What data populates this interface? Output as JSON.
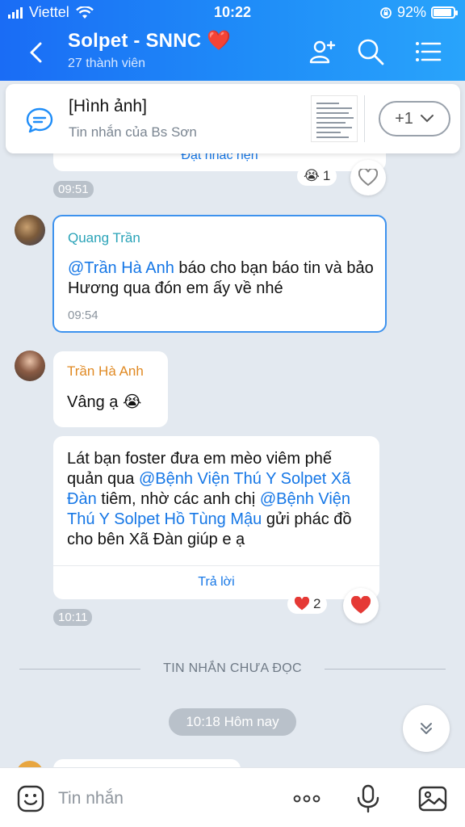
{
  "status_bar": {
    "carrier": "Viettel",
    "time": "10:22",
    "battery": "92%"
  },
  "header": {
    "title": "Solpet - SNNC ❤️",
    "subtitle": "27 thành viên"
  },
  "pinned": {
    "title": "[Hình ảnh]",
    "subtitle": "Tin nhắn của Bs Sơn",
    "more": "+1"
  },
  "messages": {
    "prev": {
      "partial_text": "Đặt nhắc hẹn",
      "time": "09:51",
      "reaction_count": "1"
    },
    "quang": {
      "sender": "Quang Trần",
      "mention": "@Trần Hà Anh",
      "text": " báo cho bạn báo tin và bảo Hương qua đón em ấy về nhé",
      "time": "09:54"
    },
    "hanh1": {
      "sender": "Trần Hà Anh",
      "text": "Vâng ạ 😭"
    },
    "hanh2": {
      "text_a": "Lát bạn foster đưa em mèo viêm phế quản qua ",
      "mention_a": "@Bệnh Viện Thú Y Solpet Xã Đàn",
      "text_b": " tiêm, nhờ các anh chị ",
      "mention_b": "@Bệnh Viện Thú Y Solpet Hồ Tùng Mậu",
      "text_c": " gửi phác đồ cho bên Xã Đàn giúp e ạ",
      "reply": "Trả lời",
      "time": "10:11",
      "reaction_count": "2"
    }
  },
  "unread_divider": "TIN NHẮN CHƯA ĐỌC",
  "date_pill": "10:18 Hôm nay",
  "input": {
    "placeholder": "Tin nhắn"
  },
  "colors": {
    "accent": "#1f8df8",
    "mention": "#1677e6",
    "sender_quang": "#2aa3b8",
    "sender_hanh": "#e08a24",
    "heart": "#e53935"
  }
}
